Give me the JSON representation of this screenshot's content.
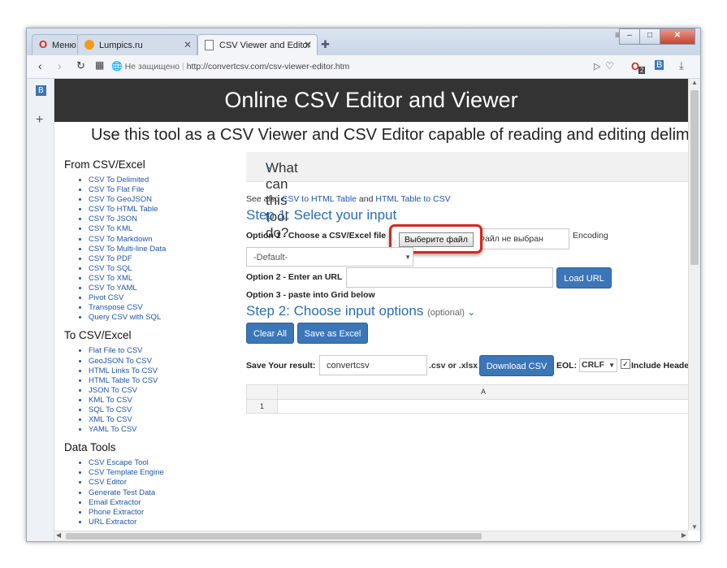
{
  "browser": {
    "tabs": [
      {
        "label": "Меню"
      },
      {
        "label": "Lumpics.ru"
      },
      {
        "label": "CSV Viewer and Editor"
      }
    ],
    "address_security": "Не защищено",
    "address_url": "http://convertcsv.com/csv-viewer-editor.htm",
    "badge_count": "2"
  },
  "page": {
    "banner_title": "Online CSV Editor and Viewer",
    "subtitle": "Use this tool as a CSV Viewer and CSV Editor capable of reading and editing delimi",
    "left_nav": [
      {
        "heading": "From CSV/Excel",
        "items": [
          "CSV To Delimited",
          "CSV To Flat File",
          "CSV To GeoJSON",
          "CSV To HTML Table",
          "CSV To JSON",
          "CSV To KML",
          "CSV To Markdown",
          "CSV To Multi-line Data",
          "CSV To PDF",
          "CSV To SQL",
          "CSV To XML",
          "CSV To YAML",
          "Pivot CSV",
          "Transpose CSV",
          "Query CSV with SQL"
        ]
      },
      {
        "heading": "To CSV/Excel",
        "items": [
          "Flat File to CSV",
          "GeoJSON To CSV",
          "HTML Links To CSV",
          "HTML Table To CSV",
          "JSON To CSV",
          "KML To CSV",
          "SQL To CSV",
          "XML To CSV",
          "YAML To CSV"
        ]
      },
      {
        "heading": "Data Tools",
        "items": [
          "CSV Escape Tool",
          "CSV Template Engine",
          "CSV Editor",
          "Generate Test Data",
          "Email Extractor",
          "Phone Extractor",
          "URL Extractor"
        ]
      }
    ],
    "what_box": "What can this tool do?",
    "see_also_prefix": "See also",
    "see_also_link1": "CSV to HTML Table",
    "see_also_and": "and",
    "see_also_link2": "HTML Table to CSV",
    "step1_title": "Step 1: Select your input",
    "option1_label": "Option 1 - Choose a CSV/Excel file",
    "file_button": "Выберите файл",
    "file_status": "Файл не выбран",
    "encoding_label": "Encoding",
    "encoding_value": "-Default-",
    "option2_label": "Option 2 - Enter an URL",
    "url_value": "",
    "load_url": "Load URL",
    "option3_label": "Option 3 - paste into Grid below",
    "step2_title": "Step 2: Choose input options",
    "step2_optional": "(optional)",
    "clear_all": "Clear All",
    "save_as_excel": "Save as Excel",
    "save_result_label": "Save Your result:",
    "filename_value": "convertcsv",
    "ext_label": ".csv or .xlsx",
    "download_csv": "Download CSV",
    "eol_label": "EOL:",
    "eol_value": "CRLF",
    "include_header": "Include Heade",
    "grid_col_a": "A",
    "grid_row_1": "1"
  },
  "colors": {
    "highlight": "#d7261e",
    "accent": "#3a76b8",
    "link": "#1f55a5"
  }
}
